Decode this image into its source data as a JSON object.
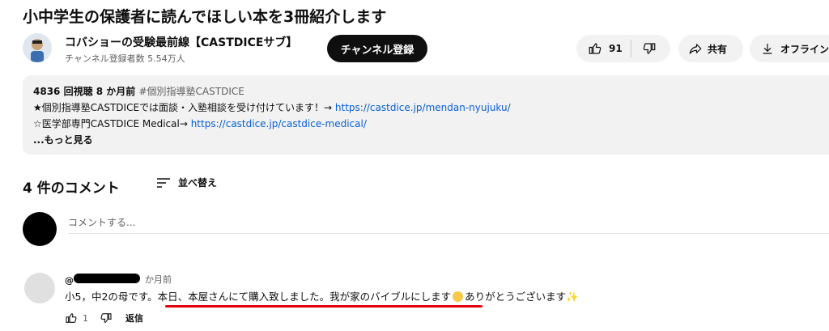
{
  "video": {
    "title": "小中学生の保護者に読んでほしい本を3冊紹介します"
  },
  "channel": {
    "name": "コバショーの受験最前線【CASTDICEサブ】",
    "subscribers": "チャンネル登録者数 5.54万人",
    "subscribe_label": "チャンネル登録"
  },
  "actions": {
    "like_count": "91",
    "share_label": "共有",
    "offline_label": "オフライン"
  },
  "description": {
    "meta": "4836 回視聴  8 か月前",
    "hashtag": "#個別指導塾CASTDICE",
    "line1_text": "★個別指導塾CASTDICEでは面談・入塾相談を受け付けています！→ ",
    "line1_link": "https://castdice.jp/mendan-nyujuku/",
    "line2_text": "☆医学部専門CASTDICE Medical→ ",
    "line2_link": "https://castdice.jp/castdice-medical/",
    "more": "...もっと見る"
  },
  "comments": {
    "count_label": "4 件のコメント",
    "sort_label": "並べ替え",
    "add_placeholder": "コメントする...",
    "items": [
      {
        "author_prefix": "@",
        "time": "か月前",
        "text_part1": "小5，中2の母です。本日、本屋さんにて購入致しました。我が家のバイブルにします",
        "text_part2": "ありがとうございます",
        "like_count": "1",
        "reply_label": "返信"
      }
    ]
  },
  "colors": {
    "link": "#065fd4",
    "highlight_underline": "#e3000f",
    "subscribe_bg": "#0f0f0f"
  }
}
